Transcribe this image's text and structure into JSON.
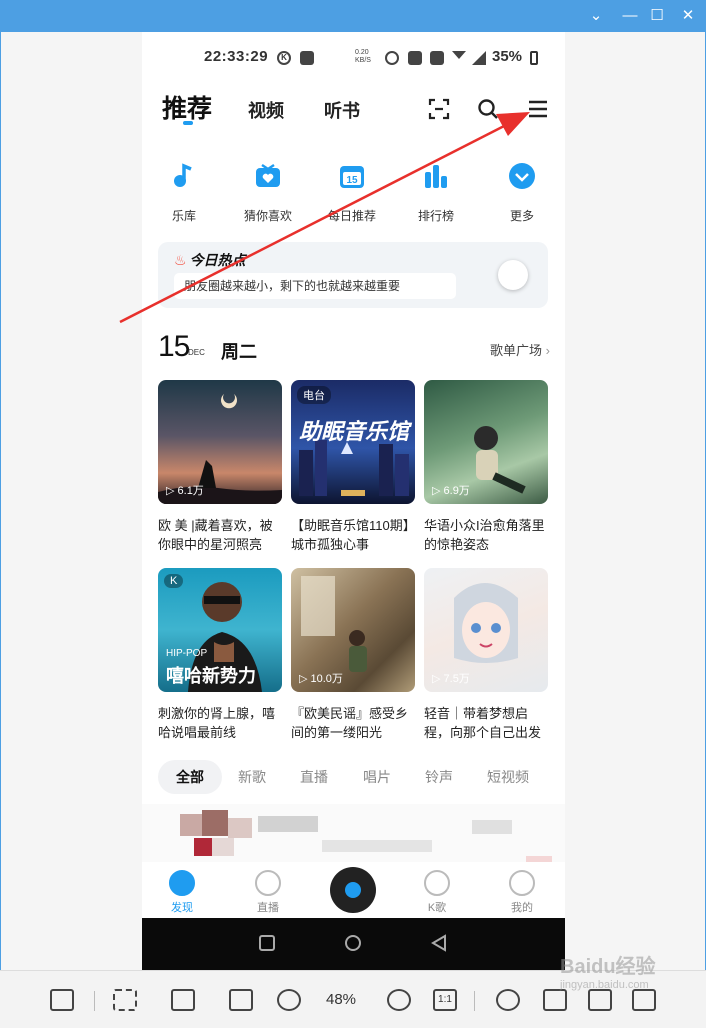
{
  "window": {
    "minimize": "⌄",
    "restore": "—",
    "maximize": "☐",
    "close": "✕"
  },
  "status_bar": {
    "time": "22:33:29",
    "net_speed": "0.20\nKB/S",
    "battery": "35%"
  },
  "nav": {
    "tabs": [
      "推荐",
      "视频",
      "听书"
    ],
    "active": "推荐"
  },
  "quick_links": [
    {
      "label": "乐库",
      "icon": "music-note-icon"
    },
    {
      "label": "猜你喜欢",
      "icon": "heart-box-icon"
    },
    {
      "label": "每日推荐",
      "icon": "calendar-icon",
      "day": "15"
    },
    {
      "label": "排行榜",
      "icon": "bar-chart-icon"
    },
    {
      "label": "更多",
      "icon": "more-chevron-icon"
    }
  ],
  "hot_today": {
    "title": "今日热点",
    "headline": "朋友圈越来越小，剩下的也就越来越重要"
  },
  "date": {
    "day": "15",
    "month": "DEC",
    "weekday": "周二",
    "link": "歌单广场"
  },
  "playlists": [
    {
      "title": "欧 美 |藏着喜欢，被你眼中的星河照亮",
      "plays": "6.1万",
      "tag": "",
      "overlay": ""
    },
    {
      "title": "【助眠音乐馆110期】城市孤独心事",
      "plays": "",
      "tag": "电台",
      "overlay": "助眠音乐馆"
    },
    {
      "title": "华语小众I治愈角落里的惊艳姿态",
      "plays": "6.9万",
      "tag": "",
      "overlay": ""
    },
    {
      "title": "刺激你的肾上腺，嘻哈说唱最前线",
      "plays": "",
      "tag": "K",
      "overlay": "嘻哈新势力",
      "sub": "HIP-POP"
    },
    {
      "title": "『欧美民谣』感受乡间的第一缕阳光",
      "plays": "10.0万",
      "tag": "",
      "overlay": ""
    },
    {
      "title": "轻音｜带着梦想启程，向那个自己出发",
      "plays": "7.5万",
      "tag": "",
      "overlay": ""
    }
  ],
  "categories": [
    "全部",
    "新歌",
    "直播",
    "唱片",
    "铃声",
    "短视频"
  ],
  "bottom_nav": [
    "发现",
    "直播",
    "K歌",
    "我的"
  ],
  "toolbar": {
    "zoom": "48%",
    "ratio": "1:1"
  },
  "watermark": {
    "brand": "Baidu经验",
    "url": "jingyan.baidu.com"
  },
  "colors": {
    "accent": "#1f9cf0",
    "titlebar": "#4d9fe3",
    "arrow": "#e8302c",
    "fire": "#f24a3a"
  }
}
